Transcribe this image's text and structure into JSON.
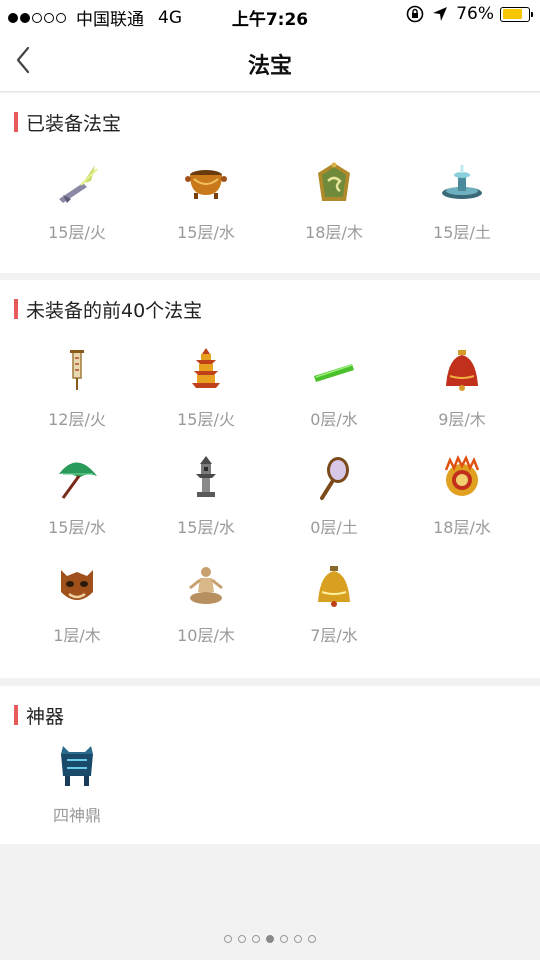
{
  "status_bar": {
    "signal_dots_on": 2,
    "signal_dots_total": 5,
    "carrier": "中国联通",
    "network": "4G",
    "time": "上午7:26",
    "battery_text": "76%",
    "battery_level": 0.76,
    "battery_color": "#f7c600"
  },
  "nav": {
    "title": "法宝",
    "back_icon": "chevron-left-icon"
  },
  "equipped": {
    "title": "已装备法宝",
    "items": [
      {
        "label": "15层/火",
        "icon": "flying-sword-icon"
      },
      {
        "label": "15层/水",
        "icon": "treasure-cauldron-icon"
      },
      {
        "label": "18层/木",
        "icon": "jade-amulet-icon"
      },
      {
        "label": "15层/土",
        "icon": "fountain-icon"
      }
    ]
  },
  "unequipped": {
    "title": "未装备的前40个法宝",
    "items": [
      {
        "label": "12层/火",
        "icon": "scroll-banner-icon"
      },
      {
        "label": "15层/火",
        "icon": "pagoda-icon"
      },
      {
        "label": "0层/水",
        "icon": "jade-ruler-icon"
      },
      {
        "label": "9层/木",
        "icon": "red-bell-icon"
      },
      {
        "label": "15层/水",
        "icon": "green-umbrella-icon"
      },
      {
        "label": "15层/水",
        "icon": "stone-lantern-icon"
      },
      {
        "label": "0层/土",
        "icon": "hand-mirror-icon"
      },
      {
        "label": "18层/水",
        "icon": "fire-ring-icon"
      },
      {
        "label": "1层/木",
        "icon": "demon-mask-icon"
      },
      {
        "label": "10层/木",
        "icon": "meditating-figure-icon"
      },
      {
        "label": "7层/水",
        "icon": "golden-bell-icon"
      }
    ]
  },
  "artifact": {
    "title": "神器",
    "items": [
      {
        "label": "四神鼎",
        "icon": "four-god-cauldron-icon"
      }
    ]
  },
  "pager": {
    "count": 7,
    "active_index": 3
  },
  "colors": {
    "accent_bar": "#e85a5a",
    "caption": "#9a9a9a",
    "background": "#f2f2f2"
  }
}
